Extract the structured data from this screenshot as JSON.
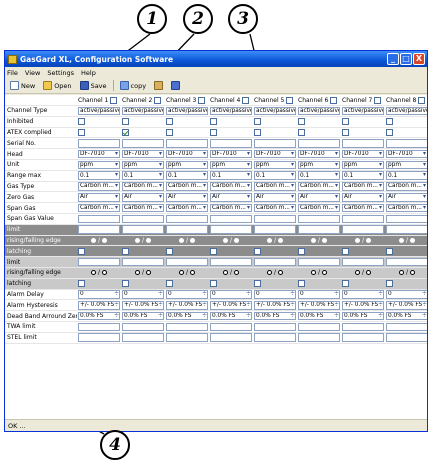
{
  "callouts": [
    "1",
    "2",
    "3",
    "4"
  ],
  "window": {
    "title": "GasGard XL, Configuration Software",
    "controls": [
      "_",
      "□",
      "X"
    ]
  },
  "menu": [
    "File",
    "View",
    "Settings",
    "Help"
  ],
  "toolbar": {
    "new_label": "New",
    "open_label": "Open",
    "save_label": "Save",
    "copy_label": "copy"
  },
  "channels": [
    "Channel 1",
    "Channel 2",
    "Channel 3",
    "Channel 4",
    "Channel 5",
    "Channel 6",
    "Channel 7",
    "Channel 8"
  ],
  "rows": [
    {
      "label": "Channel Type",
      "type": "text",
      "values": [
        "active/passive",
        "active/passive",
        "active/passive",
        "active/passive",
        "active/passive",
        "active/passive",
        "active/passive",
        "active/passive"
      ]
    },
    {
      "label": "Inhibited",
      "type": "check",
      "checked": [
        false,
        false,
        false,
        false,
        false,
        false,
        false,
        false
      ]
    },
    {
      "label": "ATEX complied",
      "type": "check",
      "checked": [
        false,
        true,
        false,
        false,
        false,
        false,
        false,
        false
      ]
    },
    {
      "label": "Serial No.",
      "type": "text",
      "values": [
        "",
        "",
        "",
        "",
        "",
        "",
        "",
        ""
      ]
    },
    {
      "label": "Head",
      "type": "select",
      "values": [
        "DF-7010",
        "DF-7010",
        "DF-7010",
        "DF-7010",
        "DF-7010",
        "DF-7010",
        "DF-7010",
        "DF-7010"
      ]
    },
    {
      "label": "Unit",
      "type": "select",
      "values": [
        "ppm",
        "ppm",
        "ppm",
        "ppm",
        "ppm",
        "ppm",
        "ppm",
        "ppm"
      ]
    },
    {
      "label": "Range max",
      "type": "select",
      "values": [
        "0.1",
        "0.1",
        "0.1",
        "0.1",
        "0.1",
        "0.1",
        "0.1",
        "0.1"
      ]
    },
    {
      "label": "Gas Type",
      "type": "select",
      "values": [
        "Carbon m...",
        "Carbon m...",
        "Carbon m...",
        "Carbon m...",
        "Carbon m...",
        "Carbon m...",
        "Carbon m...",
        "Carbon m..."
      ]
    },
    {
      "label": "Zero Gas",
      "type": "select",
      "values": [
        "Air",
        "Air",
        "Air",
        "Air",
        "Air",
        "Air",
        "Air",
        "Air"
      ]
    },
    {
      "label": "Span Gas",
      "type": "select",
      "values": [
        "Carbon m...",
        "Carbon m...",
        "Carbon m...",
        "Carbon m...",
        "Carbon m...",
        "Carbon m...",
        "Carbon m...",
        "Carbon m..."
      ]
    },
    {
      "label": "Span Gas Value",
      "type": "text",
      "values": [
        "",
        "",
        "",
        "",
        "",
        "",
        "",
        ""
      ]
    },
    {
      "label": "limit",
      "type": "text",
      "shade": "dark",
      "values": [
        "",
        "",
        "",
        "",
        "",
        "",
        "",
        ""
      ]
    },
    {
      "label": "rising/falling edge",
      "type": "radio",
      "shade": "dark"
    },
    {
      "label": "latching",
      "type": "check",
      "shade": "dark",
      "checked": [
        false,
        false,
        false,
        false,
        false,
        false,
        false,
        false
      ]
    },
    {
      "label": "limit",
      "type": "text",
      "shade": "light",
      "values": [
        "",
        "",
        "",
        "",
        "",
        "",
        "",
        ""
      ]
    },
    {
      "label": "rising/falling edge",
      "type": "radio",
      "shade": "light"
    },
    {
      "label": "latching",
      "type": "check",
      "shade": "light",
      "checked": [
        false,
        false,
        false,
        false,
        false,
        false,
        false,
        false
      ]
    },
    {
      "label": "Alarm Delay",
      "type": "spin",
      "values": [
        "0",
        "0",
        "0",
        "0",
        "0",
        "0",
        "0",
        "0"
      ]
    },
    {
      "label": "Alarm Hysteresis",
      "type": "spin",
      "values": [
        "+/- 0.0% FS",
        "+/- 0.0% FS",
        "+/- 0.0% FS",
        "+/- 0.0% FS",
        "+/- 0.0% FS",
        "+/- 0.0% FS",
        "+/- 0.0% FS",
        "+/- 0.0% FS"
      ]
    },
    {
      "label": "Dead Band Arround Zero",
      "type": "spin",
      "values": [
        "0.0% FS",
        "0.0% FS",
        "0.0% FS",
        "0.0% FS",
        "0.0% FS",
        "0.0% FS",
        "0.0% FS",
        "0.0% FS"
      ]
    },
    {
      "label": "TWA limit",
      "type": "text",
      "values": [
        "",
        "",
        "",
        "",
        "",
        "",
        "",
        ""
      ]
    },
    {
      "label": "STEL limit",
      "type": "text",
      "values": [
        "",
        "",
        "",
        "",
        "",
        "",
        "",
        ""
      ]
    }
  ],
  "status": "OK ...",
  "radio_glyph": "/"
}
